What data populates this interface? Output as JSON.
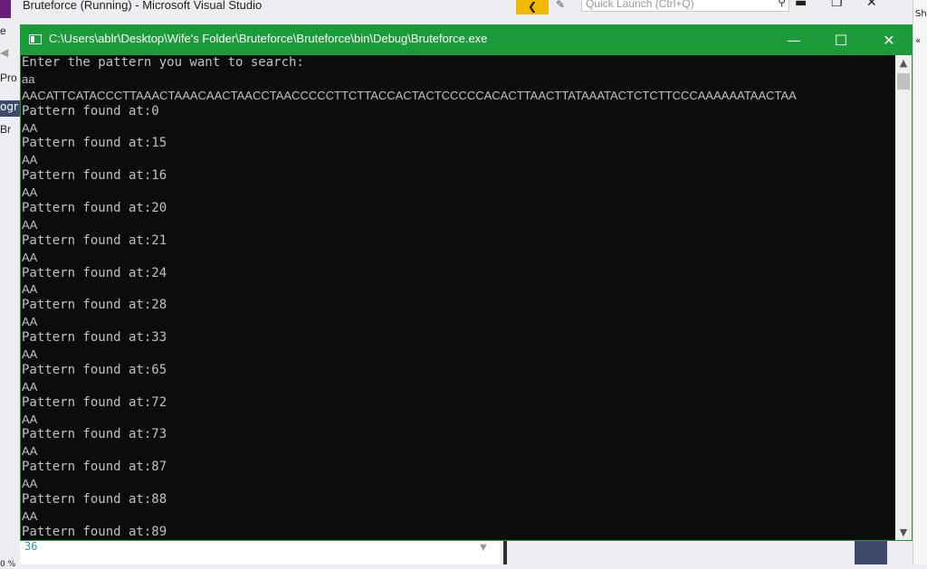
{
  "vs": {
    "title": "Bruteforce (Running) - Microsoft Visual Studio",
    "notification": "❮",
    "quick_launch_placeholder": "Quick Launch (Ctrl+Q)",
    "left_fragments": [
      "e",
      "Pro",
      "ogr",
      "Br"
    ],
    "right_fragment": "Shar",
    "line_number": "36",
    "zoom": "0 %"
  },
  "console": {
    "title": "C:\\Users\\ablr\\Desktop\\Wife's Folder\\Bruteforce\\Bruteforce\\bin\\Debug\\Bruteforce.exe",
    "minimize": "—",
    "maximize": "☐",
    "close": "✕",
    "lines": [
      {
        "text": "Enter the pattern you want to search:",
        "style": "mono"
      },
      {
        "text": "aa",
        "style": "prop"
      },
      {
        "text": "AACATTCATACCCTTAAACTAAACAACTAACCTAACCCCCTTCTTACCACTACTCCCCCACACTTAACTTATAAATACTCTCTTCCCAAAAAATAACTAA",
        "style": "prop"
      },
      {
        "text": "Pattern found at:0",
        "style": "mono"
      },
      {
        "text": "AA",
        "style": "prop"
      },
      {
        "text": "Pattern found at:15",
        "style": "mono"
      },
      {
        "text": "AA",
        "style": "prop"
      },
      {
        "text": "Pattern found at:16",
        "style": "mono"
      },
      {
        "text": "AA",
        "style": "prop"
      },
      {
        "text": "Pattern found at:20",
        "style": "mono"
      },
      {
        "text": "AA",
        "style": "prop"
      },
      {
        "text": "Pattern found at:21",
        "style": "mono"
      },
      {
        "text": "AA",
        "style": "prop"
      },
      {
        "text": "Pattern found at:24",
        "style": "mono"
      },
      {
        "text": "AA",
        "style": "prop"
      },
      {
        "text": "Pattern found at:28",
        "style": "mono"
      },
      {
        "text": "AA",
        "style": "prop"
      },
      {
        "text": "Pattern found at:33",
        "style": "mono"
      },
      {
        "text": "AA",
        "style": "prop"
      },
      {
        "text": "Pattern found at:65",
        "style": "mono"
      },
      {
        "text": "AA",
        "style": "prop"
      },
      {
        "text": "Pattern found at:72",
        "style": "mono"
      },
      {
        "text": "AA",
        "style": "prop"
      },
      {
        "text": "Pattern found at:73",
        "style": "mono"
      },
      {
        "text": "AA",
        "style": "prop"
      },
      {
        "text": "Pattern found at:87",
        "style": "mono"
      },
      {
        "text": "AA",
        "style": "prop"
      },
      {
        "text": "Pattern found at:88",
        "style": "mono"
      },
      {
        "text": "AA",
        "style": "prop"
      },
      {
        "text": "Pattern found at:89",
        "style": "mono"
      }
    ]
  },
  "colors": {
    "titlebar": "#1c9b3a",
    "console_bg": "#0c0c0c",
    "console_text": "#c0c0c0",
    "vs_accent": "#68217a"
  }
}
